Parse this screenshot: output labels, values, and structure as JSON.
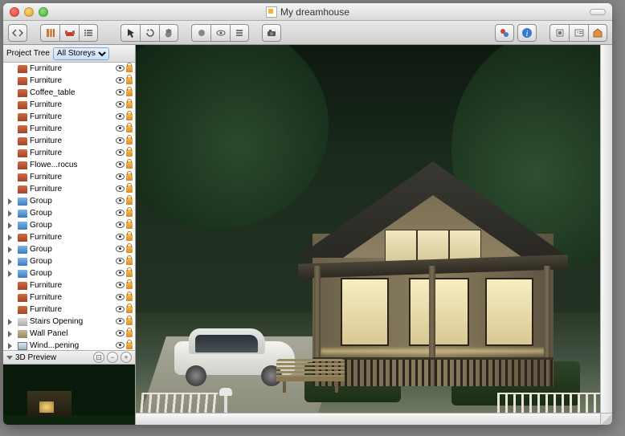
{
  "window": {
    "title": "My dreamhouse"
  },
  "toolbar": {
    "left": [
      "back-forward",
      "bookcase-icon",
      "sofa-icon",
      "list-icon"
    ],
    "mid": [
      "pointer-icon",
      "rotate-icon",
      "hand-icon",
      "record-icon",
      "eye-view-icon",
      "stack-icon",
      "camera-icon"
    ],
    "right": [
      "materials-icon",
      "info-icon",
      "first-person-icon",
      "library-icon",
      "home-icon"
    ]
  },
  "sidebar": {
    "header_label": "Project Tree",
    "storey_selector": {
      "selected": "All Storeys",
      "options": [
        "All Storeys"
      ]
    },
    "items": [
      {
        "type": "furn",
        "label": "Furniture",
        "exp": false
      },
      {
        "type": "furn",
        "label": "Furniture",
        "exp": false
      },
      {
        "type": "furn",
        "label": "Coffee_table",
        "exp": false
      },
      {
        "type": "furn",
        "label": "Furniture",
        "exp": false
      },
      {
        "type": "furn",
        "label": "Furniture",
        "exp": false
      },
      {
        "type": "furn",
        "label": "Furniture",
        "exp": false
      },
      {
        "type": "furn",
        "label": "Furniture",
        "exp": false
      },
      {
        "type": "furn",
        "label": "Furniture",
        "exp": false
      },
      {
        "type": "furn",
        "label": "Flowe...rocus",
        "exp": false
      },
      {
        "type": "furn",
        "label": "Furniture",
        "exp": false
      },
      {
        "type": "furn",
        "label": "Furniture",
        "exp": false
      },
      {
        "type": "group",
        "label": "Group",
        "exp": true
      },
      {
        "type": "group",
        "label": "Group",
        "exp": true
      },
      {
        "type": "group",
        "label": "Group",
        "exp": true
      },
      {
        "type": "furn",
        "label": "Furniture",
        "exp": true
      },
      {
        "type": "group",
        "label": "Group",
        "exp": true
      },
      {
        "type": "group",
        "label": "Group",
        "exp": true
      },
      {
        "type": "group",
        "label": "Group",
        "exp": true
      },
      {
        "type": "furn",
        "label": "Furniture",
        "exp": false
      },
      {
        "type": "furn",
        "label": "Furniture",
        "exp": false
      },
      {
        "type": "furn",
        "label": "Furniture",
        "exp": false
      },
      {
        "type": "stairs",
        "label": "Stairs Opening",
        "exp": true
      },
      {
        "type": "wall",
        "label": "Wall Panel",
        "exp": true
      },
      {
        "type": "wind",
        "label": "Wind...pening",
        "exp": true
      }
    ],
    "preview_label": "3D Preview"
  }
}
